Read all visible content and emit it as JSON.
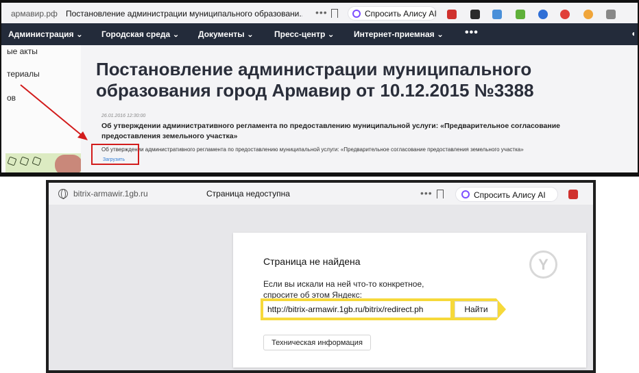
{
  "top": {
    "browser": {
      "domain": "армавир.рф",
      "tab_title": "Постановление администрации муниципального образовани...",
      "alice_label": "Спросить Алису AI"
    },
    "nav": {
      "items": [
        "Администрация",
        "Городская среда",
        "Документы",
        "Пресс-центр",
        "Интернет-приемная"
      ],
      "more": "•••"
    },
    "sidebar": {
      "items": [
        "ые акты",
        "териалы",
        "ов"
      ]
    },
    "page": {
      "heading": "Постановление администрации муниципального образования город Армавир от 10.12.2015 №3388",
      "doc_date": "26.01.2016 12:30:00",
      "doc_title": "Об утверждении административного регламента по предоставлению муниципальной услуги: «Предварительное согласование предоставления земельного участка»",
      "doc_description": "Об утверждении административного регламента по предоставлению муниципальной услуги: «Предварительное согласование предоставления земельного участка»",
      "download_label": "Загрузить"
    },
    "annotation_color": "#d21b1b"
  },
  "bottom": {
    "browser": {
      "domain": "bitrix-armawir.1gb.ru",
      "tab_title": "Страница недоступна",
      "alice_label": "Спросить Алису AI"
    },
    "error_page": {
      "title": "Страница не найдена",
      "text": "Если вы искали на ней что-то конкретное, спросите об этом Яндекс:",
      "search_value": "http://bitrix-armawir.1gb.ru/bitrix/redirect.ph",
      "search_button": "Найти",
      "tech_button": "Техническая информация"
    },
    "accent_color": "#f6d93a"
  }
}
